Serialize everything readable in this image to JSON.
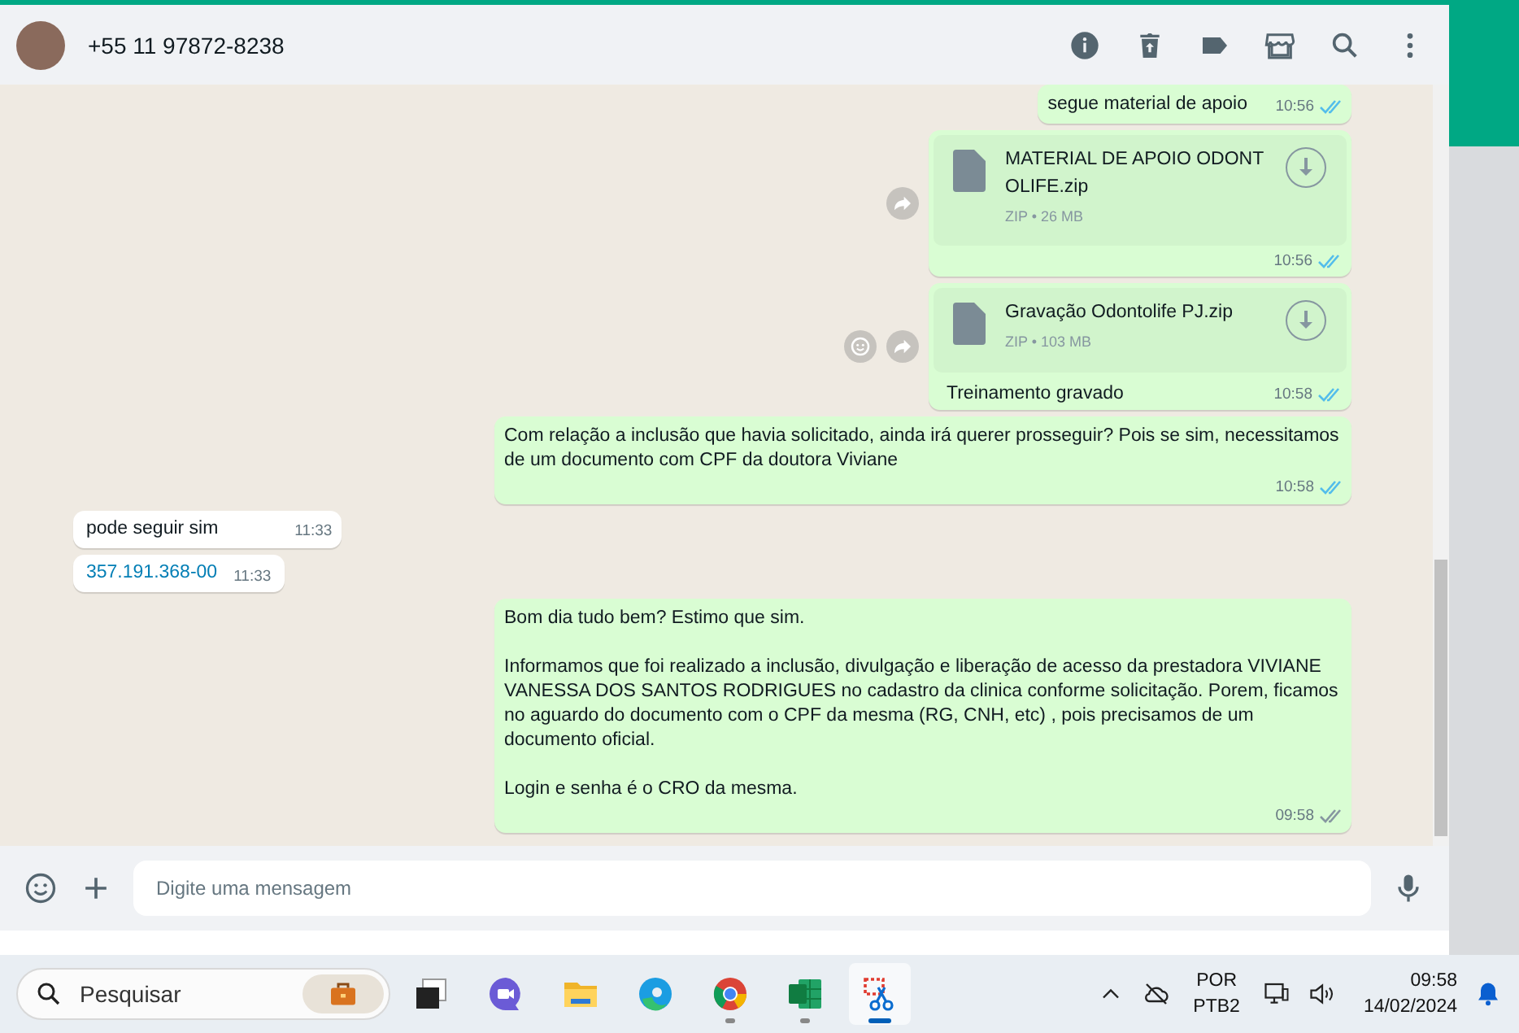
{
  "chat_header": {
    "contact": "+55 11 97872-8238"
  },
  "messages": [
    {
      "kind": "text",
      "outgoing": true,
      "text": "segue material de apoio",
      "time": "10:56",
      "read": true
    },
    {
      "kind": "file",
      "outgoing": true,
      "file_name": "MATERIAL DE APOIO ODONTOLIFE.zip",
      "file_info": "ZIP • 26 MB",
      "time": "10:56",
      "read": true,
      "react_button": false
    },
    {
      "kind": "file",
      "outgoing": true,
      "file_name": "Gravação Odontolife PJ.zip",
      "file_info": "ZIP • 103 MB",
      "caption": "Treinamento gravado",
      "time": "10:58",
      "read": true,
      "react_button": true
    },
    {
      "kind": "text",
      "outgoing": true,
      "text": "Com relação a inclusão que havia solicitado, ainda irá querer prosseguir? Pois se sim, necessitamos de um documento com CPF da doutora Viviane",
      "time": "10:58",
      "read": true
    },
    {
      "kind": "text",
      "outgoing": false,
      "text": "pode seguir sim",
      "time": "11:33"
    },
    {
      "kind": "link",
      "outgoing": false,
      "text": "357.191.368-00",
      "time": "11:33"
    },
    {
      "kind": "text",
      "outgoing": true,
      "text": "Bom dia tudo bem? Estimo que sim.\n\nInformamos que foi realizado a inclusão, divulgação e liberação de acesso da prestadora VIVIANE VANESSA DOS SANTOS RODRIGUES no cadastro da clinica conforme solicitação. Porem, ficamos no aguardo do documento com o CPF da mesma (RG, CNH, etc) , pois precisamos de um documento oficial.\n\nLogin e senha é o CRO da mesma.",
      "time": "09:58",
      "read": false
    }
  ],
  "composer": {
    "placeholder": "Digite uma mensagem"
  },
  "taskbar": {
    "search_placeholder": "Pesquisar",
    "apps": [
      {
        "kind": "taskview",
        "running": false,
        "selected": false
      },
      {
        "kind": "meet",
        "running": false,
        "selected": false
      },
      {
        "kind": "folder",
        "running": false,
        "selected": false
      },
      {
        "kind": "edge",
        "running": false,
        "selected": false
      },
      {
        "kind": "chrome",
        "running": true,
        "selected": false
      },
      {
        "kind": "excel",
        "running": true,
        "selected": false
      },
      {
        "kind": "snip",
        "running": true,
        "selected": true
      }
    ],
    "language": "POR",
    "keyboard": "PTB2",
    "time": "09:58",
    "date": "14/02/2024"
  }
}
